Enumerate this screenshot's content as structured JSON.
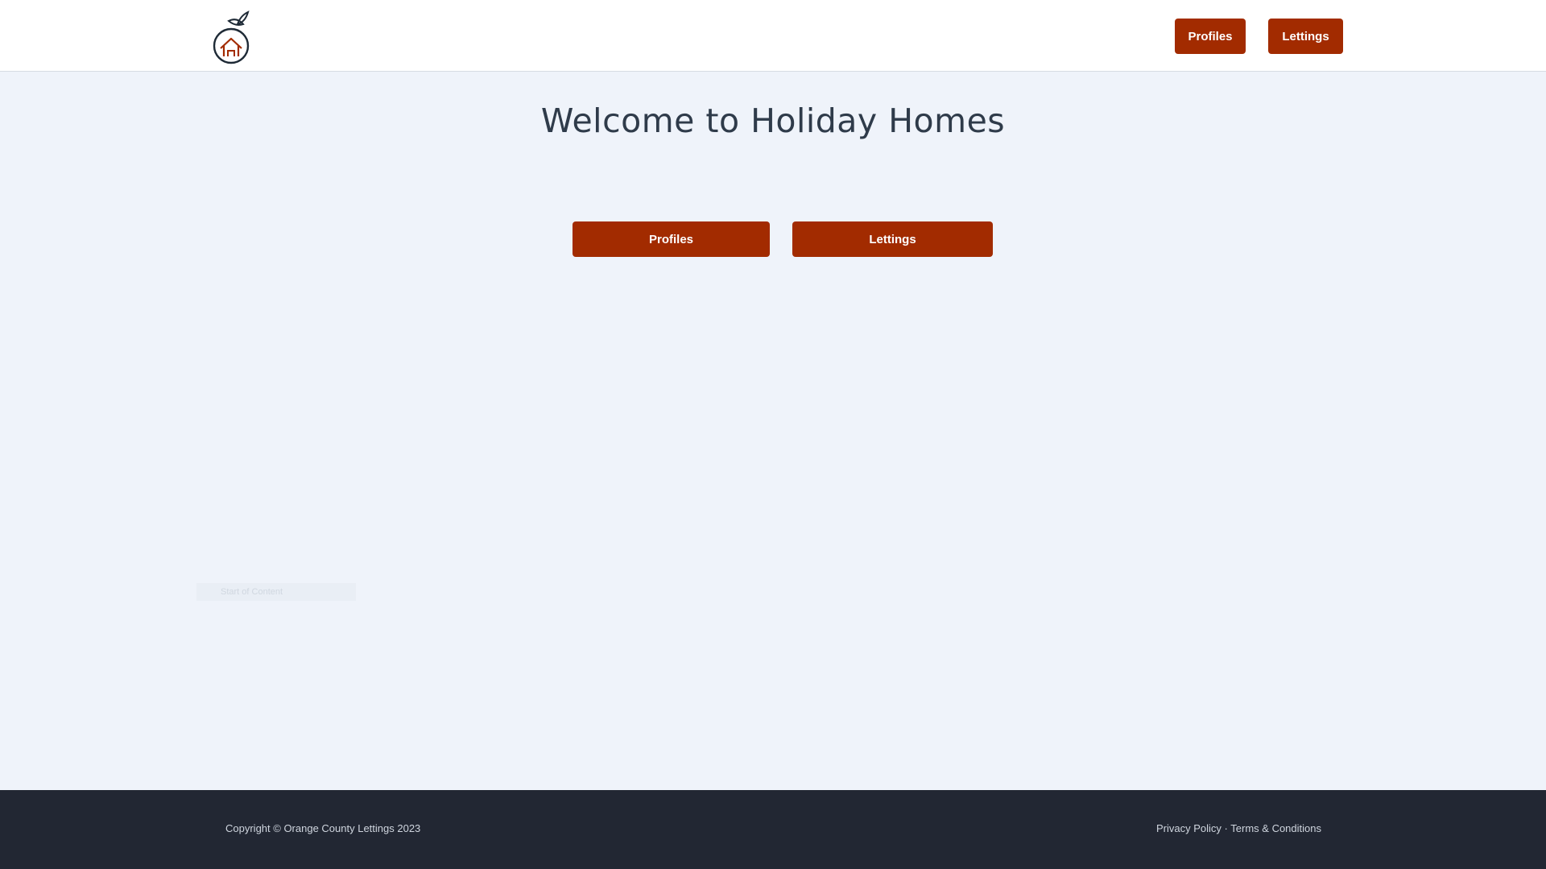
{
  "header": {
    "logo_icon": "orange-house-logo-icon",
    "nav": [
      {
        "label": "Profiles"
      },
      {
        "label": "Lettings"
      }
    ]
  },
  "main": {
    "title": "Welcome to Holiday Homes",
    "buttons": [
      {
        "label": "Profiles"
      },
      {
        "label": "Lettings"
      }
    ],
    "faint_text": "Start of Content"
  },
  "footer": {
    "copyright": "Copyright © Orange County Lettings 2023",
    "privacy": "Privacy Policy",
    "separator": "·",
    "terms": "Terms & Conditions"
  },
  "colors": {
    "accent": "#a22b00",
    "background": "#eff3fa",
    "footer_bg": "#222733",
    "title": "#2f3b4a"
  }
}
